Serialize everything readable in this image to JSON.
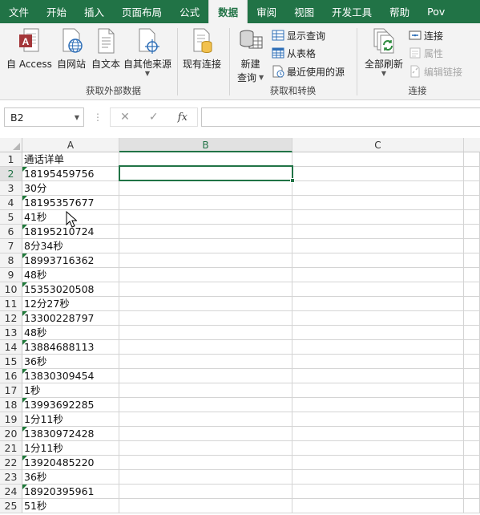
{
  "menu": {
    "tabs": [
      "文件",
      "开始",
      "插入",
      "页面布局",
      "公式",
      "数据",
      "审阅",
      "视图",
      "开发工具",
      "帮助",
      "Pov"
    ],
    "active_index": 5
  },
  "ribbon": {
    "external_data": {
      "label": "获取外部数据",
      "buttons": [
        "自 Access",
        "自网站",
        "自文本",
        "自其他来源",
        "现有连接"
      ]
    },
    "get_transform": {
      "label": "获取和转换",
      "new_query_line1": "新建",
      "new_query_line2": "查询",
      "show_queries": "显示查询",
      "from_table": "从表格",
      "recent_sources": "最近使用的源"
    },
    "connections": {
      "label": "连接",
      "refresh_all": "全部刷新",
      "connections": "连接",
      "properties": "属性",
      "edit_links": "编辑链接"
    }
  },
  "formula_bar": {
    "name_box": "B2",
    "cancel": "✕",
    "enter": "✓",
    "fx": "fx",
    "value": ""
  },
  "grid": {
    "columns": [
      "A",
      "B",
      "C"
    ],
    "selected_cell": "B2",
    "rows": [
      {
        "n": "1",
        "a": "通话详单",
        "flag": false
      },
      {
        "n": "2",
        "a": "18195459756",
        "flag": true
      },
      {
        "n": "3",
        "a": "30分",
        "flag": false
      },
      {
        "n": "4",
        "a": "18195357677",
        "flag": true
      },
      {
        "n": "5",
        "a": "41秒",
        "flag": false
      },
      {
        "n": "6",
        "a": "18195210724",
        "flag": true
      },
      {
        "n": "7",
        "a": "8分34秒",
        "flag": false
      },
      {
        "n": "8",
        "a": "18993716362",
        "flag": true
      },
      {
        "n": "9",
        "a": "48秒",
        "flag": false
      },
      {
        "n": "10",
        "a": "15353020508",
        "flag": true
      },
      {
        "n": "11",
        "a": "12分27秒",
        "flag": false
      },
      {
        "n": "12",
        "a": "13300228797",
        "flag": true
      },
      {
        "n": "13",
        "a": "48秒",
        "flag": false
      },
      {
        "n": "14",
        "a": "13884688113",
        "flag": true
      },
      {
        "n": "15",
        "a": "36秒",
        "flag": false
      },
      {
        "n": "16",
        "a": "13830309454",
        "flag": true
      },
      {
        "n": "17",
        "a": "1秒",
        "flag": false
      },
      {
        "n": "18",
        "a": "13993692285",
        "flag": true
      },
      {
        "n": "19",
        "a": "1分11秒",
        "flag": false
      },
      {
        "n": "20",
        "a": "13830972428",
        "flag": true
      },
      {
        "n": "21",
        "a": "1分11秒",
        "flag": false
      },
      {
        "n": "22",
        "a": "13920485220",
        "flag": true
      },
      {
        "n": "23",
        "a": "36秒",
        "flag": false
      },
      {
        "n": "24",
        "a": "18920395961",
        "flag": true
      },
      {
        "n": "25",
        "a": "51秒",
        "flag": false
      }
    ]
  },
  "colors": {
    "accent": "#217346",
    "text_number_flag": "#1f7a3a"
  }
}
